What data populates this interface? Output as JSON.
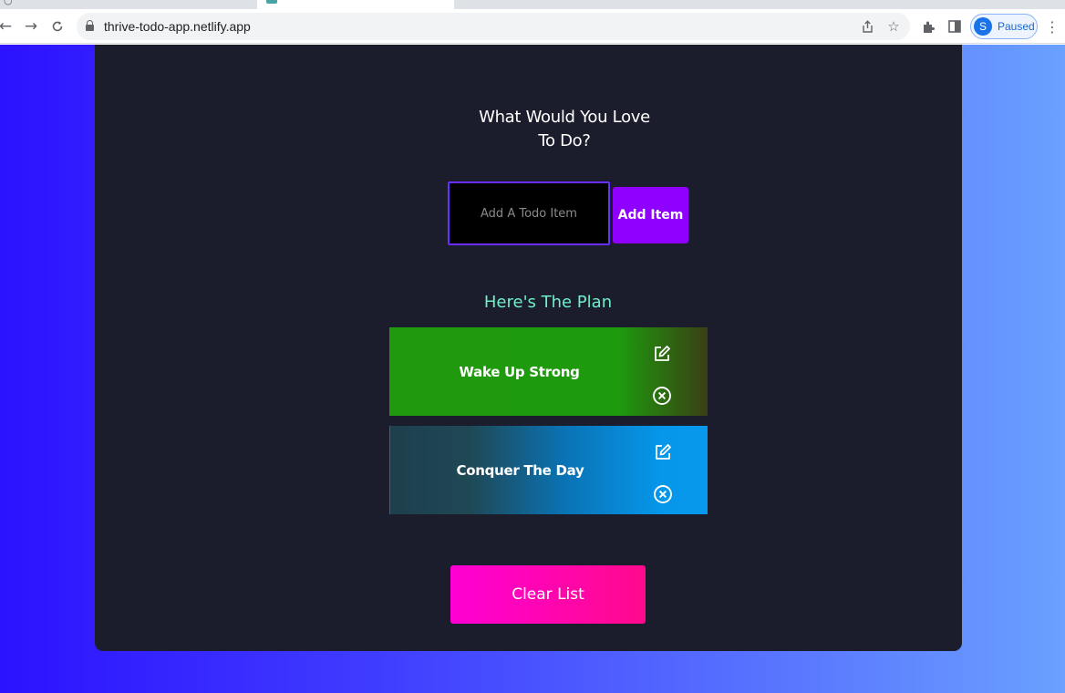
{
  "browser": {
    "url": "thrive-todo-app.netlify.app",
    "profile_initial": "S",
    "profile_status": "Paused"
  },
  "app": {
    "heading": "What Would You Love To Do?",
    "input_placeholder": "Add A Todo Item",
    "add_button": "Add Item",
    "list_title": "Here's The Plan",
    "todos": [
      {
        "text": "Wake Up Strong"
      },
      {
        "text": "Conquer The Day"
      }
    ],
    "clear_button": "Clear List"
  },
  "colors": {
    "card_bg": "#1b1c2c",
    "input_border": "#6a2cff",
    "add_button": "#8f00ff",
    "list_title": "#6ff0c8",
    "todo_green": "#1f9a0c",
    "todo_blue": "#0799ee",
    "clear_button": "#ff00d4"
  }
}
